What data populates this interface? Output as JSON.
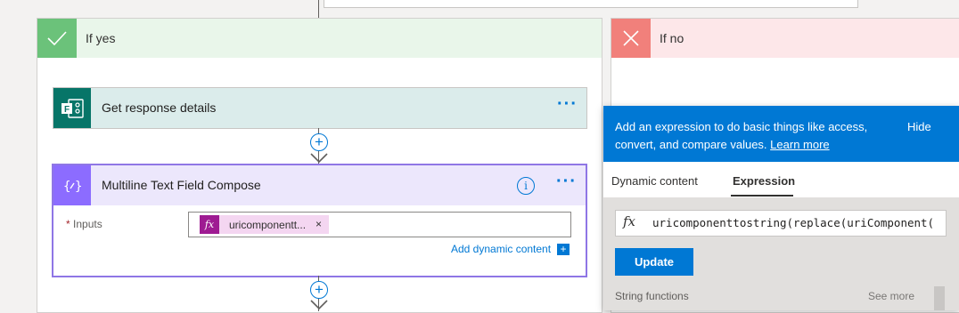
{
  "branches": {
    "yes_label": "If yes",
    "no_label": "If no"
  },
  "cards": {
    "get_response": {
      "title": "Get response details",
      "icon": "forms-icon",
      "color": "#077568"
    },
    "compose": {
      "title": "Multiline Text Field Compose",
      "icon": "compose-icon",
      "color": "#8c6cff",
      "info_icon_glyph": "i",
      "inputs_label": "Inputs",
      "required_marker": "*",
      "token": {
        "fx": "fx",
        "text": "uricomponentt...",
        "remove": "×"
      },
      "add_dynamic_content": "Add dynamic content",
      "add_dynamic_icon": "+"
    }
  },
  "menu_dots": "···",
  "add_step_glyph": "+",
  "expression_panel": {
    "banner_text": "Add an expression to do basic things like access, convert, and compare values.",
    "learn_more": "Learn more",
    "hide": "Hide",
    "tabs": [
      "Dynamic content",
      "Expression"
    ],
    "active_tab": "Expression",
    "fx": "fx",
    "expression": "uricomponenttostring(replace(uriComponent(",
    "update_button": "Update",
    "section_title": "String functions",
    "see_more": "See more"
  },
  "colors": {
    "accent": "#0078d4",
    "yes": "#6bc27a",
    "no": "#f1807b",
    "token": "#9e1b92"
  }
}
